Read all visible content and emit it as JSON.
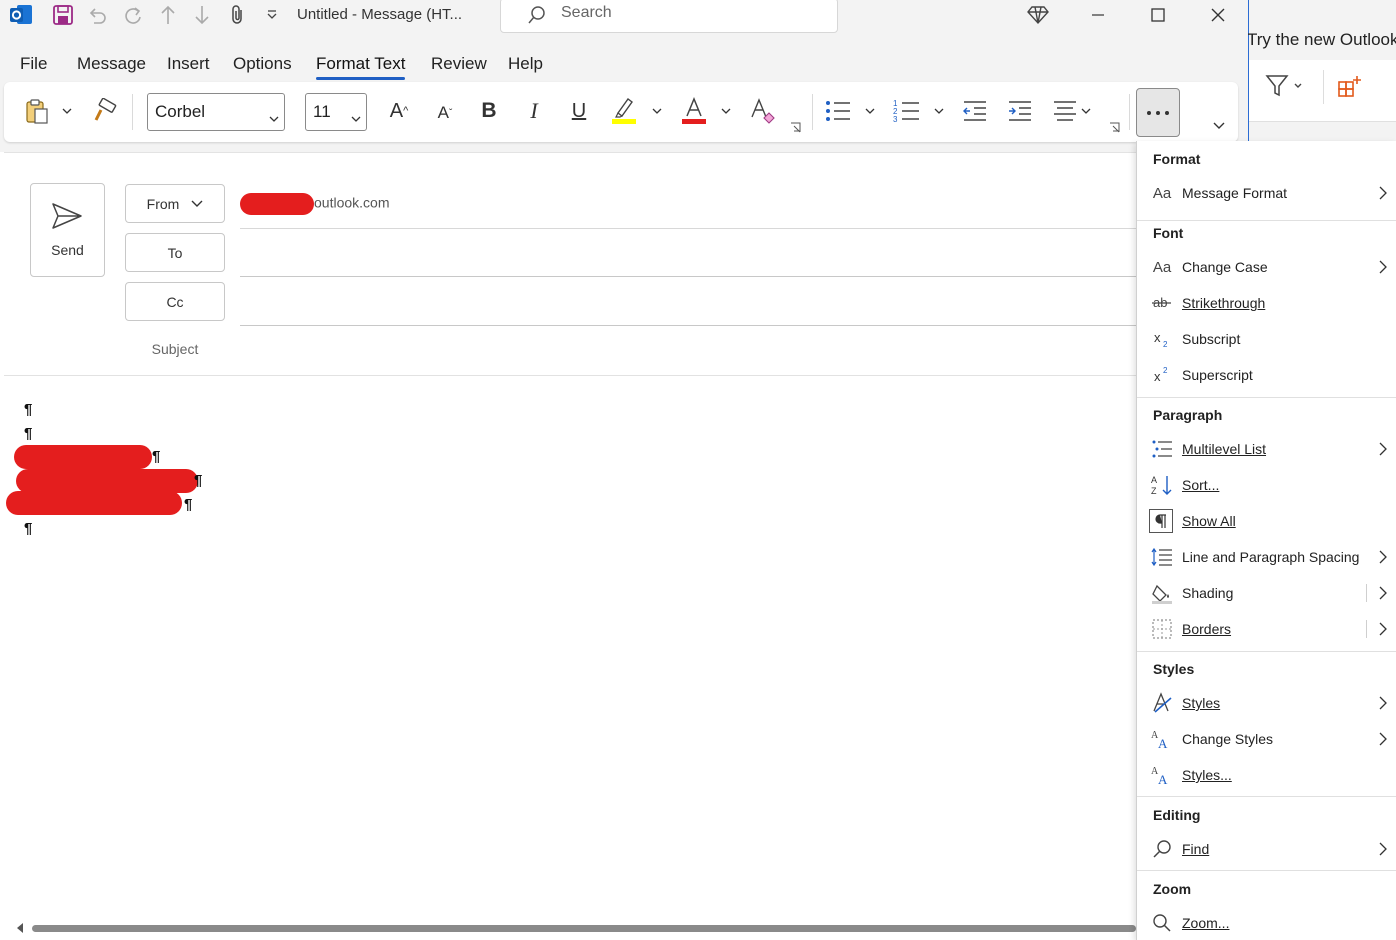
{
  "window": {
    "title": "Untitled  -  Message (HT...",
    "search_placeholder": "Search",
    "background_text": "Try the new Outlook"
  },
  "tabs": [
    {
      "label": "File"
    },
    {
      "label": "Message"
    },
    {
      "label": "Insert"
    },
    {
      "label": "Options"
    },
    {
      "label": "Format Text",
      "active": true
    },
    {
      "label": "Review"
    },
    {
      "label": "Help"
    }
  ],
  "ribbon": {
    "font_name": "Corbel",
    "font_size": "11",
    "highlight_color": "#ffff00",
    "font_color": "#e41e1e"
  },
  "compose": {
    "send_label": "Send",
    "from_label": "From",
    "to_label": "To",
    "cc_label": "Cc",
    "subject_label": "Subject",
    "from_address_suffix": "outlook.com",
    "pilcrow": "¶"
  },
  "menu": {
    "sections": {
      "format": "Format",
      "font": "Font",
      "paragraph": "Paragraph",
      "styles": "Styles",
      "editing": "Editing",
      "zoom": "Zoom"
    },
    "items": {
      "message_format": "Message Format",
      "change_case": "Change Case",
      "strikethrough": "Strikethrough",
      "subscript": "Subscript",
      "superscript": "Superscript",
      "multilevel_list": "Multilevel List",
      "sort": "Sort...",
      "show_all": "Show All",
      "line_spacing": "Line and Paragraph Spacing",
      "shading": "Shading",
      "borders": "Borders",
      "styles": "Styles",
      "change_styles": "Change Styles",
      "styles_dialog": "Styles...",
      "find": "Find",
      "zoom": "Zoom..."
    },
    "icon_glyphs": {
      "aa": "Aa"
    }
  },
  "colors": {
    "accent": "#1f5fc4",
    "redaction": "#e41e1e"
  }
}
